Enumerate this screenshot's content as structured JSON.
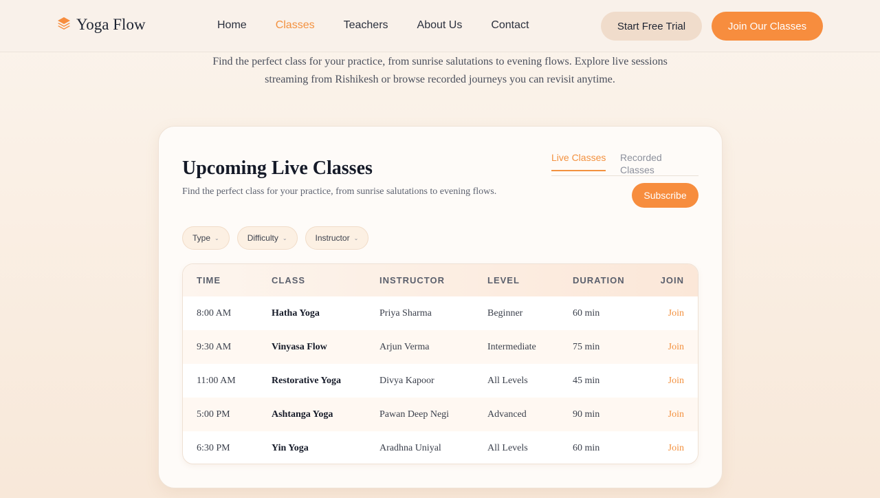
{
  "brand": {
    "name": "Yoga Flow",
    "accent": "#f78d3e",
    "logo_icon": "layers-icon"
  },
  "nav": {
    "items": [
      {
        "label": "Home",
        "active": false
      },
      {
        "label": "Classes",
        "active": true
      },
      {
        "label": "Teachers",
        "active": false
      },
      {
        "label": "About Us",
        "active": false
      },
      {
        "label": "Contact",
        "active": false
      }
    ]
  },
  "header": {
    "trial_label": "Start Free Trial",
    "join_label": "Join Our Classes"
  },
  "intro": "Find the perfect class for your practice, from sunrise salutations to evening flows. Explore live sessions streaming from Rishikesh or browse recorded journeys you can revisit anytime.",
  "card": {
    "title": "Upcoming Live Classes",
    "subtitle": "Find the perfect class for your practice, from sunrise salutations to evening flows.",
    "tabs": [
      {
        "label": "Live Classes",
        "active": true
      },
      {
        "label": "Recorded Classes",
        "active": false
      }
    ],
    "subscribe_label": "Subscribe",
    "filters": [
      "Type",
      "Difficulty",
      "Instructor"
    ],
    "columns": [
      "TIME",
      "CLASS",
      "INSTRUCTOR",
      "LEVEL",
      "DURATION",
      "JOIN"
    ],
    "rows": [
      {
        "time": "8:00 AM",
        "class": "Hatha Yoga",
        "instructor": "Priya Sharma",
        "level": "Beginner",
        "duration": "60 min",
        "join": "Join"
      },
      {
        "time": "9:30 AM",
        "class": "Vinyasa Flow",
        "instructor": "Arjun Verma",
        "level": "Intermediate",
        "duration": "75 min",
        "join": "Join"
      },
      {
        "time": "11:00 AM",
        "class": "Restorative Yoga",
        "instructor": "Divya Kapoor",
        "level": "All Levels",
        "duration": "45 min",
        "join": "Join"
      },
      {
        "time": "5:00 PM",
        "class": "Ashtanga Yoga",
        "instructor": "Pawan Deep Negi",
        "level": "Advanced",
        "duration": "90 min",
        "join": "Join"
      },
      {
        "time": "6:30 PM",
        "class": "Yin Yoga",
        "instructor": "Aradhna Uniyal",
        "level": "All Levels",
        "duration": "60 min",
        "join": "Join"
      }
    ]
  }
}
